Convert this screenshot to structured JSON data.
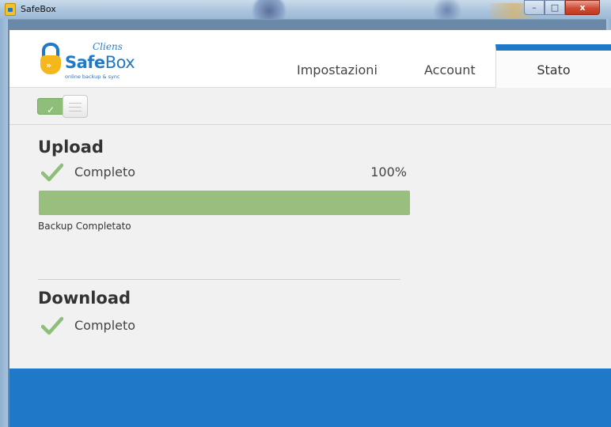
{
  "window": {
    "title": "SafeBox",
    "minimize": "–",
    "maximize": "□",
    "close": "x"
  },
  "logo": {
    "top": "Cliens",
    "name_bold": "Safe",
    "name_light": "Box",
    "tagline": "online backup & sync",
    "lock_glyph": "»"
  },
  "tabs": [
    {
      "label": "Impostazioni"
    },
    {
      "label": "Account"
    },
    {
      "label": "Stato",
      "active": true
    }
  ],
  "toggle": {
    "on": true,
    "check": "✓"
  },
  "upload": {
    "title": "Upload",
    "status": "Completo",
    "percent_label": "100%",
    "progress": 1.0,
    "message": "Backup Completato"
  },
  "download": {
    "title": "Download",
    "status": "Completo"
  },
  "colors": {
    "accent": "#1f78c8",
    "success": "#8fbd7a",
    "progress_fill": "#98bf7e",
    "lock": "#f4b81c"
  }
}
